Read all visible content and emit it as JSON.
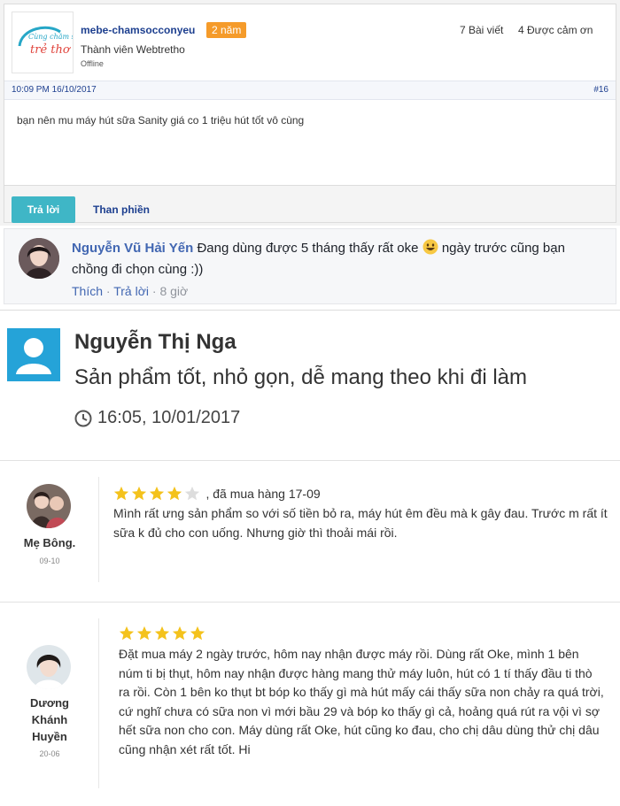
{
  "forum_post": {
    "logo_text": "Cùng chăm sóc trẻ thơ",
    "username": "mebe-chamsocconyeu",
    "badge": "2 năm",
    "role": "Thành viên Webtretho",
    "status": "Offline",
    "posts": "7 Bài viết",
    "thanks": "4 Được cảm ơn",
    "datetime": "10:09 PM 16/10/2017",
    "post_number": "#16",
    "body": "bạn nên mu máy hút sữa Sanity giá co 1 triệu hút tốt vô cùng",
    "reply_label": "Trả lời",
    "complain_label": "Than phiền"
  },
  "fb_comment": {
    "name": "Nguyễn Vũ Hải Yến",
    "text_before_emoji": "Đang dùng được 5 tháng thấy rất oke",
    "text_after_emoji": "ngày trước cũng bạn chồng đi chọn cùng :))",
    "like": "Thích",
    "reply": "Trả lời",
    "separator": "·",
    "time": "8 giờ",
    "emoji_icon": "smile-icon"
  },
  "review": {
    "name": "Nguyễn Thị Nga",
    "text": "Sản phẩm tốt, nhỏ gọn, dễ mang theo khi đi làm",
    "time": "16:05, 10/01/2017",
    "avatar_color": "#25a3d8"
  },
  "shop_reviews": [
    {
      "name_lines": [
        "Mẹ Bông."
      ],
      "date": "09-10",
      "rating": 4,
      "max_rating": 5,
      "purchase": ", đã mua hàng 17-09",
      "text": "Mình rất ưng sản phẩm so với số tiền bỏ ra, máy hút êm đều mà k gây đau. Trước m rất ít sữa k đủ cho con uống. Nhưng giờ thì thoải mái rồi."
    },
    {
      "name_lines": [
        "Dương",
        "Khánh",
        "Huyền"
      ],
      "date": "20-06",
      "rating": 5,
      "max_rating": 5,
      "purchase": "",
      "text": "Đặt mua máy 2 ngày trước, hôm nay nhận được máy rồi. Dùng rất Oke, mình 1 bên núm ti bị thụt, hôm nay nhận được hàng mang thử máy luôn, hút có 1 tí thấy đầu ti thò ra rồi. Còn 1 bên ko thụt bt bóp ko thấy gì mà hút mấy cái thấy sữa non chảy ra quá trời, cứ nghĩ chưa có sữa non vì mới bầu 29 và bóp ko thấy gì cả, hoảng quá rút ra vội vì sợ hết sữa non cho con. Máy dùng rất Oke, hút cũng ko đau, cho chị dâu dùng thử chị dâu cũng nhận xét rất tốt. Hi"
    }
  ],
  "colors": {
    "star_filled": "#f4c21c",
    "star_empty": "#dddddd",
    "link_blue": "#1d3f8f",
    "fb_blue": "#4267b2",
    "reply_button": "#3fb6c6",
    "badge_orange": "#f59b2a"
  }
}
